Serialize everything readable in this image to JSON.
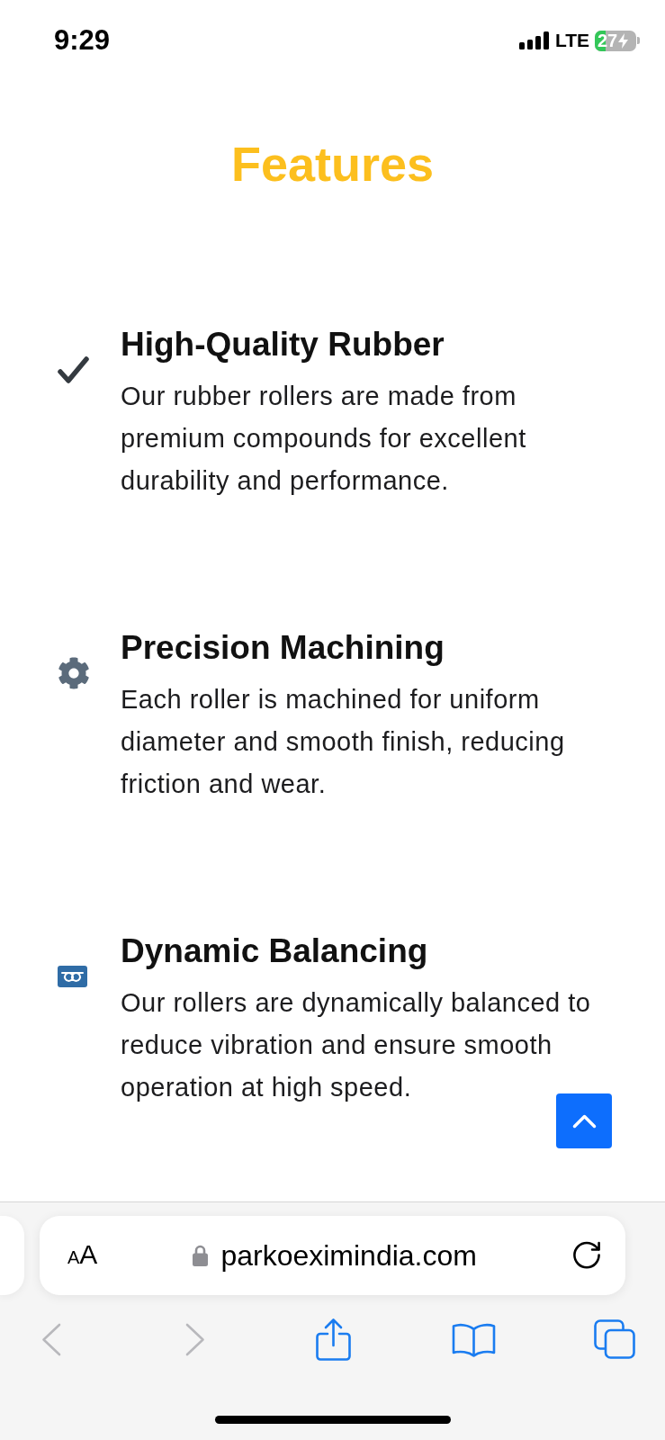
{
  "status_bar": {
    "time": "9:29",
    "network": "LTE",
    "battery": "27"
  },
  "page": {
    "heading": "Features",
    "features": [
      {
        "kind": "check",
        "title": "High-Quality Rubber",
        "description": "Our rubber rollers are made from premium compounds for excellent durability and performance."
      },
      {
        "kind": "gear",
        "title": "Precision Machining",
        "description": "Each roller is machined for uniform diameter and smooth finish, reducing friction and wear."
      },
      {
        "kind": "loop",
        "title": "Dynamic Balancing",
        "description": "Our rollers are dynamically balanced to reduce vibration and ensure smooth operation at high speed."
      }
    ]
  },
  "browser": {
    "text_size_button": "AA",
    "url": "parkoeximindia.com",
    "toolbar": [
      {
        "kind": "back",
        "disabled": true
      },
      {
        "kind": "forward",
        "disabled": true
      },
      {
        "kind": "share",
        "disabled": false
      },
      {
        "kind": "bookmarks",
        "disabled": false
      },
      {
        "kind": "tabs",
        "disabled": false
      }
    ]
  }
}
